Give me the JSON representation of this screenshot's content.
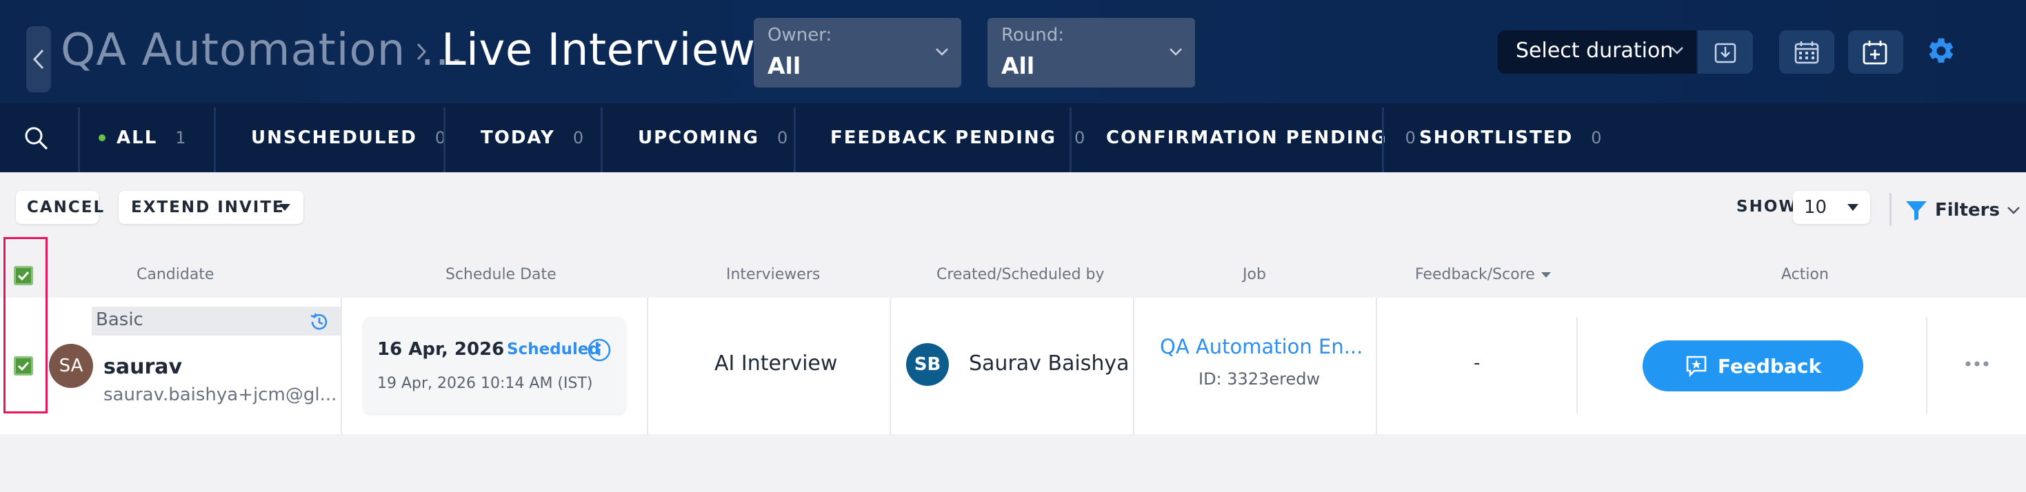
{
  "header": {
    "breadcrumb_parent": "QA Automation ...",
    "breadcrumb_current": "Live Interviews",
    "owner_label": "Owner:",
    "owner_value": "All",
    "round_label": "Round:",
    "round_value": "All",
    "duration_label": "Select duration"
  },
  "tabs": [
    {
      "label": "ALL",
      "count": "1"
    },
    {
      "label": "UNSCHEDULED",
      "count": "0"
    },
    {
      "label": "TODAY",
      "count": "0"
    },
    {
      "label": "UPCOMING",
      "count": "0"
    },
    {
      "label": "FEEDBACK PENDING",
      "count": "0"
    },
    {
      "label": "CONFIRMATION PENDING",
      "count": "0"
    },
    {
      "label": "SHORTLISTED",
      "count": "0"
    }
  ],
  "toolbar": {
    "cancel_label": "CANCEL",
    "extend_invite_label": "EXTEND INVITE",
    "show_label": "SHOW",
    "show_value": "10",
    "filters_label": "Filters"
  },
  "columns": {
    "candidate": "Candidate",
    "schedule_date": "Schedule Date",
    "interviewers": "Interviewers",
    "created_by": "Created/Scheduled by",
    "job": "Job",
    "feedback_score": "Feedback/Score",
    "action": "Action"
  },
  "row": {
    "tag": "Basic",
    "avatar_initials": "SA",
    "candidate_name": "saurav",
    "candidate_email": "saurav.baishya+jcm@gl...",
    "schedule_date": "16 Apr, 2026",
    "schedule_status": "Scheduled",
    "schedule_datetime": "19 Apr, 2026 10:14 AM (IST)",
    "interviewers": "AI Interview",
    "creator_initials": "SB",
    "creator_name": "Saurav Baishya",
    "job_title": "QA Automation En...",
    "job_id": "ID: 3323eredw",
    "feedback_score": "-",
    "action_label": "Feedback"
  },
  "colors": {
    "header_bg": "#0b2751",
    "tabs_bg": "#0a1f44",
    "accent_blue": "#2196f3",
    "checkbox_green": "#4f9a3a",
    "highlight_red": "#e5155b",
    "active_dot": "#6cc04a"
  }
}
